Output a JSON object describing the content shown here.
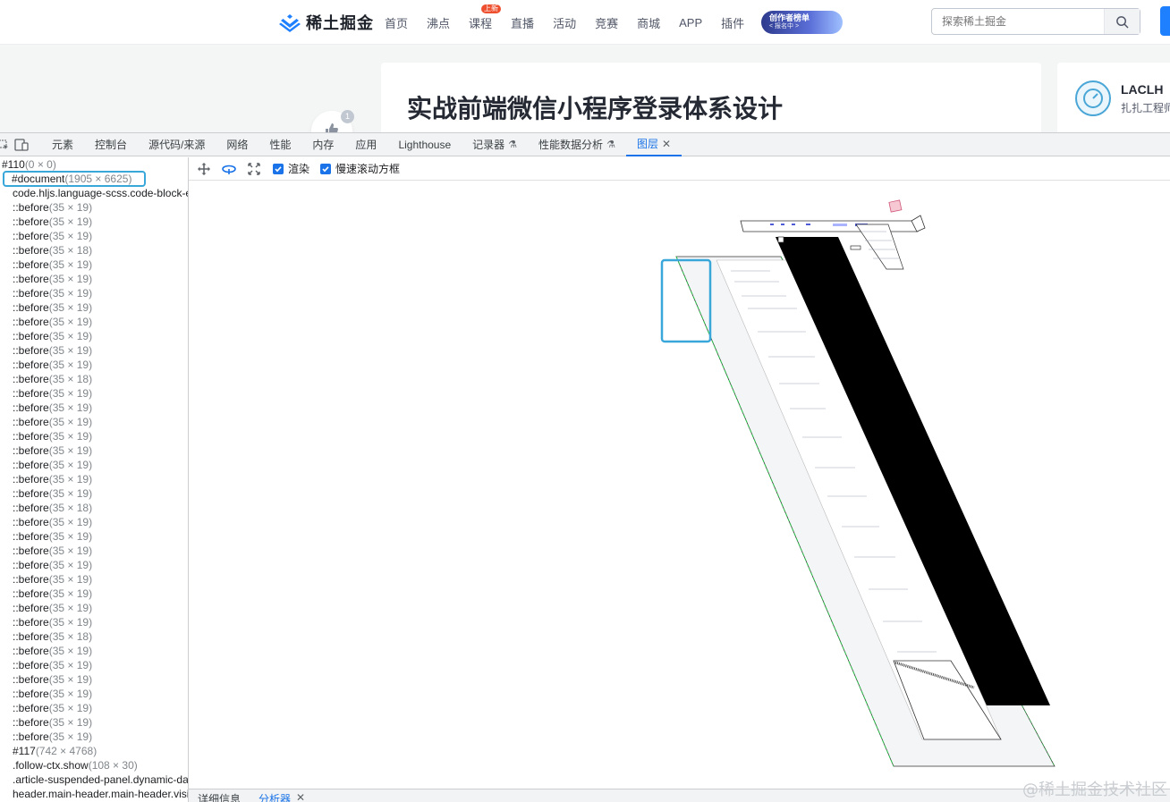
{
  "site": {
    "logo_text": "稀土掘金",
    "nav": [
      {
        "label": "首页",
        "badge": ""
      },
      {
        "label": "沸点",
        "badge": ""
      },
      {
        "label": "课程",
        "badge": "上新"
      },
      {
        "label": "直播",
        "badge": ""
      },
      {
        "label": "活动",
        "badge": ""
      },
      {
        "label": "竞赛",
        "badge": ""
      },
      {
        "label": "商城",
        "badge": ""
      },
      {
        "label": "APP",
        "badge": ""
      },
      {
        "label": "插件",
        "badge": ""
      }
    ],
    "promo": {
      "title": "创作者榜单",
      "sub": "< 报名中 >"
    },
    "search_placeholder": "探索稀土掘金"
  },
  "article": {
    "title": "实战前端微信小程序登录体系设计",
    "like_count": "1",
    "author_name": "LACLH",
    "author_title": "扎扎工程师"
  },
  "devtools": {
    "tabs": [
      {
        "label": "元素",
        "flask": false,
        "active": false,
        "closable": false
      },
      {
        "label": "控制台",
        "flask": false,
        "active": false,
        "closable": false
      },
      {
        "label": "源代码/来源",
        "flask": false,
        "active": false,
        "closable": false
      },
      {
        "label": "网络",
        "flask": false,
        "active": false,
        "closable": false
      },
      {
        "label": "性能",
        "flask": false,
        "active": false,
        "closable": false
      },
      {
        "label": "内存",
        "flask": false,
        "active": false,
        "closable": false
      },
      {
        "label": "应用",
        "flask": false,
        "active": false,
        "closable": false
      },
      {
        "label": "Lighthouse",
        "flask": false,
        "active": false,
        "closable": false
      },
      {
        "label": "记录器",
        "flask": true,
        "active": false,
        "closable": false
      },
      {
        "label": "性能数据分析",
        "flask": true,
        "active": false,
        "closable": false
      },
      {
        "label": "图层",
        "flask": false,
        "active": true,
        "closable": true
      }
    ],
    "toolbar": {
      "render_label": "渲染",
      "slow_scroll_label": "慢速滚动方框"
    },
    "tree": [
      {
        "name": "#110",
        "dim": "(0 × 0)",
        "root": true
      },
      {
        "name": "#document",
        "dim": "(1905 × 6625)",
        "selected": true
      },
      {
        "name": "code.hljs.language-scss.code-block-extension-codeShowNum",
        "dim": ""
      },
      {
        "name": "::before",
        "dim": "(35 × 19)"
      },
      {
        "name": "::before",
        "dim": "(35 × 19)"
      },
      {
        "name": "::before",
        "dim": "(35 × 19)"
      },
      {
        "name": "::before",
        "dim": "(35 × 18)"
      },
      {
        "name": "::before",
        "dim": "(35 × 19)"
      },
      {
        "name": "::before",
        "dim": "(35 × 19)"
      },
      {
        "name": "::before",
        "dim": "(35 × 19)"
      },
      {
        "name": "::before",
        "dim": "(35 × 19)"
      },
      {
        "name": "::before",
        "dim": "(35 × 19)"
      },
      {
        "name": "::before",
        "dim": "(35 × 19)"
      },
      {
        "name": "::before",
        "dim": "(35 × 19)"
      },
      {
        "name": "::before",
        "dim": "(35 × 19)"
      },
      {
        "name": "::before",
        "dim": "(35 × 18)"
      },
      {
        "name": "::before",
        "dim": "(35 × 19)"
      },
      {
        "name": "::before",
        "dim": "(35 × 19)"
      },
      {
        "name": "::before",
        "dim": "(35 × 19)"
      },
      {
        "name": "::before",
        "dim": "(35 × 19)"
      },
      {
        "name": "::before",
        "dim": "(35 × 19)"
      },
      {
        "name": "::before",
        "dim": "(35 × 19)"
      },
      {
        "name": "::before",
        "dim": "(35 × 19)"
      },
      {
        "name": "::before",
        "dim": "(35 × 19)"
      },
      {
        "name": "::before",
        "dim": "(35 × 18)"
      },
      {
        "name": "::before",
        "dim": "(35 × 19)"
      },
      {
        "name": "::before",
        "dim": "(35 × 19)"
      },
      {
        "name": "::before",
        "dim": "(35 × 19)"
      },
      {
        "name": "::before",
        "dim": "(35 × 19)"
      },
      {
        "name": "::before",
        "dim": "(35 × 19)"
      },
      {
        "name": "::before",
        "dim": "(35 × 19)"
      },
      {
        "name": "::before",
        "dim": "(35 × 19)"
      },
      {
        "name": "::before",
        "dim": "(35 × 19)"
      },
      {
        "name": "::before",
        "dim": "(35 × 18)"
      },
      {
        "name": "::before",
        "dim": "(35 × 19)"
      },
      {
        "name": "::before",
        "dim": "(35 × 19)"
      },
      {
        "name": "::before",
        "dim": "(35 × 19)"
      },
      {
        "name": "::before",
        "dim": "(35 × 19)"
      },
      {
        "name": "::before",
        "dim": "(35 × 19)"
      },
      {
        "name": "::before",
        "dim": "(35 × 19)"
      },
      {
        "name": "::before",
        "dim": "(35 × 19)"
      },
      {
        "name": "#117",
        "dim": "(742 × 4768)"
      },
      {
        "name": ".follow-ctx.show",
        "dim": "(108 × 30)"
      },
      {
        "name": ".article-suspended-panel.dynamic-data-ready",
        "dim": ""
      },
      {
        "name": "header.main-header.main-header.visible",
        "dim": ""
      }
    ],
    "bottom_tabs": [
      {
        "label": "详细信息",
        "active": false,
        "closable": false
      },
      {
        "label": "分析器",
        "active": true,
        "closable": true
      }
    ]
  },
  "watermark": "@稀土掘金技术社区",
  "colors": {
    "brand": "#1e80ff",
    "devtools_accent": "#1a73e8",
    "selection": "#3aa7db"
  }
}
